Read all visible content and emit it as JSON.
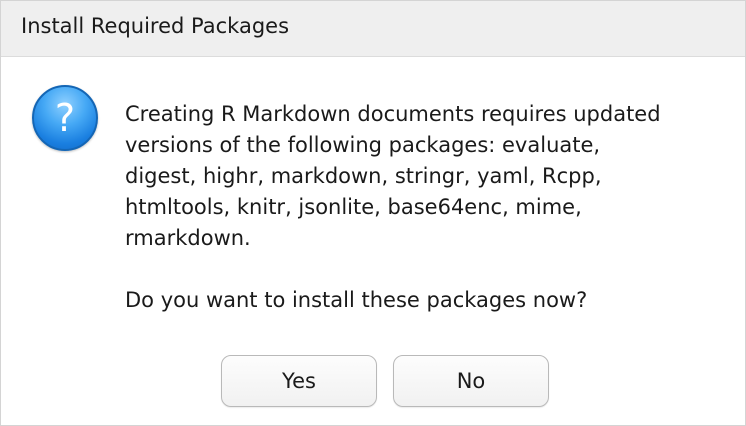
{
  "window": {
    "title": "Install Required Packages"
  },
  "icon": {
    "name": "question-icon",
    "glyph": "?",
    "color": "#1a7fe0"
  },
  "message": {
    "lines": [
      "Creating R Markdown documents requires updated",
      "versions of the following packages: evaluate,",
      "digest, highr, markdown, stringr, yaml, Rcpp,",
      "htmltools, knitr, jsonlite, base64enc, mime,",
      "rmarkdown."
    ],
    "question": "Do you want to install these packages now?"
  },
  "buttons": {
    "yes_label": "Yes",
    "no_label": "No"
  }
}
